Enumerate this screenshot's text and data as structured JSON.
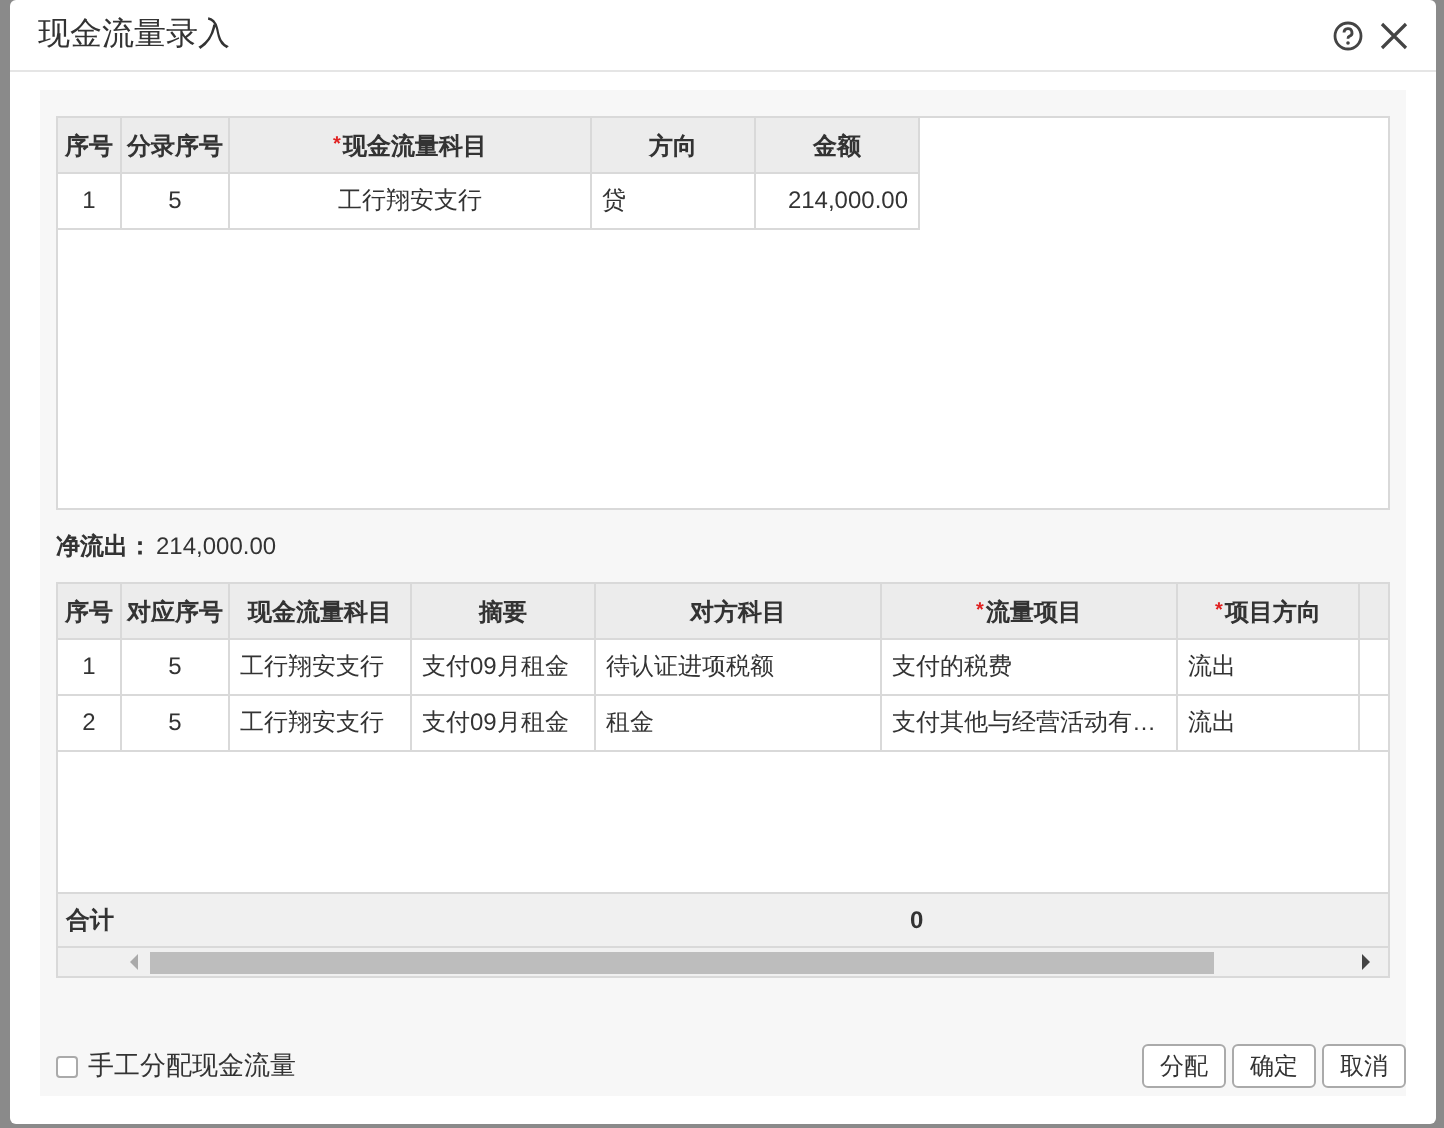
{
  "dialog": {
    "title": "现金流量录入"
  },
  "entry_table": {
    "columns": [
      {
        "label": "序号"
      },
      {
        "label": "分录序号"
      },
      {
        "label": "现金流量科目",
        "mark": "*"
      },
      {
        "label": "方向"
      },
      {
        "label": "金额"
      }
    ],
    "rows": [
      [
        "1",
        "5",
        "工行翔安支行",
        "贷",
        "214,000.00"
      ]
    ]
  },
  "net": {
    "label": "净流出：",
    "value": "214,000.00"
  },
  "flow_table": {
    "columns": [
      {
        "label": "序号"
      },
      {
        "label": "对应序号"
      },
      {
        "label": "现金流量科目"
      },
      {
        "label": "摘要"
      },
      {
        "label": "对方科目"
      },
      {
        "label": "流量项目",
        "mark": "*"
      },
      {
        "label": "项目方向",
        "mark": "*"
      }
    ],
    "rows": [
      [
        "1",
        "5",
        "工行翔安支行",
        "支付09月租金",
        "待认证进项税额",
        "支付的税费",
        "流出"
      ],
      [
        "2",
        "5",
        "工行翔安支行",
        "支付09月租金",
        "租金",
        "支付其他与经营活动有…",
        "流出"
      ]
    ],
    "total": {
      "label": "合计",
      "value": "0"
    }
  },
  "manual": {
    "label": "手工分配现金流量",
    "checked": false
  },
  "buttons": [
    "分配",
    "确定",
    "取消"
  ]
}
